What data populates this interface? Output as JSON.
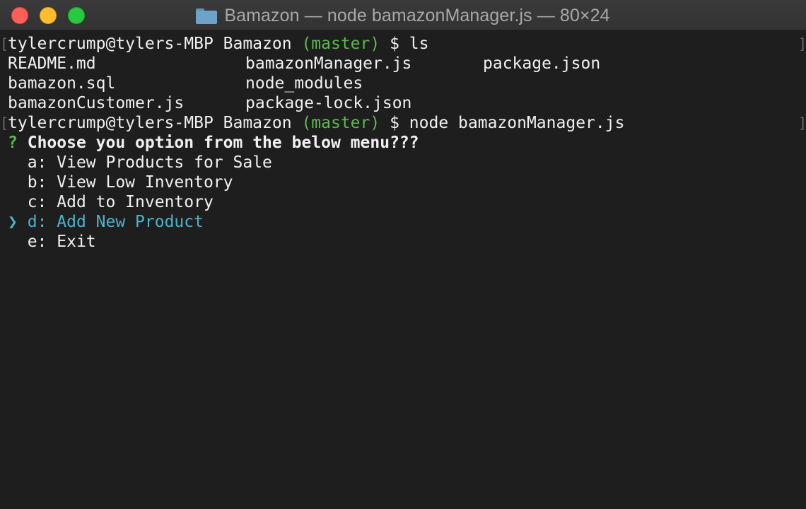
{
  "window": {
    "title": "Bamazon — node bamazonManager.js — 80×24"
  },
  "prompt": {
    "user_host": "tylercrump@tylers-MBP Bamazon",
    "branch": "(master)",
    "dollar": "$"
  },
  "commands": {
    "first": "ls",
    "second": "node bamazonManager.js"
  },
  "ls_output": {
    "col1": [
      "README.md",
      "bamazon.sql",
      "bamazonCustomer.js"
    ],
    "col2": [
      "bamazonManager.js",
      "node_modules",
      "package-lock.json"
    ],
    "col3": [
      "package.json"
    ]
  },
  "menu": {
    "question_mark": "?",
    "question": "Choose you option from the below menu???",
    "pointer": "❯",
    "options": [
      "a: View Products for Sale",
      "b: View Low Inventory",
      "c: Add to Inventory",
      "d: Add New Product",
      "e: Exit"
    ],
    "selected_index": 3
  },
  "colors": {
    "background": "#1e1e1e",
    "text": "#f0f0f0",
    "git_branch": "#5bb94b",
    "selected": "#4bb3c9"
  },
  "icons": {
    "folder": "folder-icon"
  }
}
